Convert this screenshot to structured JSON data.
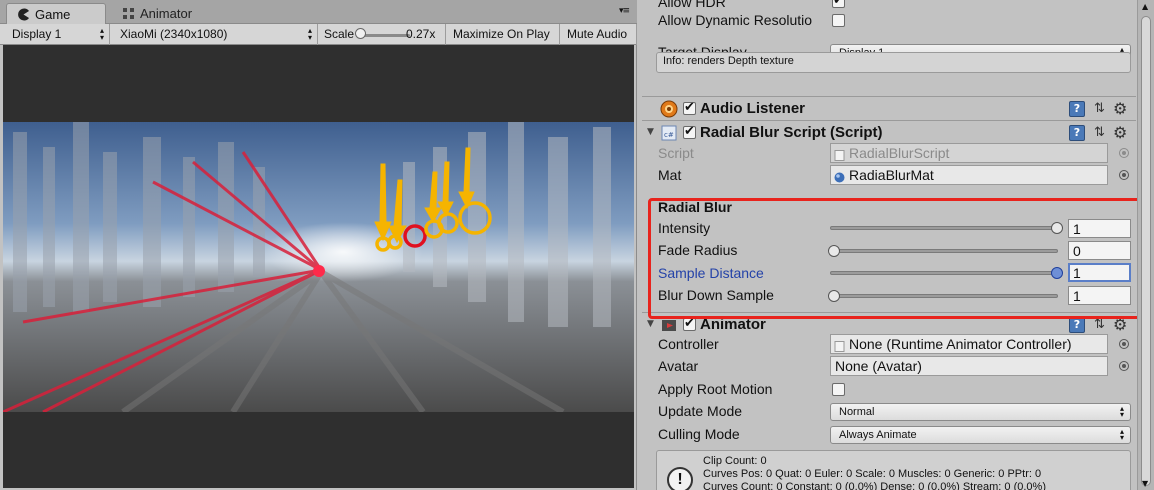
{
  "game_view": {
    "tabs": [
      {
        "label": "Game",
        "icon": "pacman-icon"
      },
      {
        "label": "Animator",
        "icon": "animator-grid-icon"
      }
    ],
    "toolbar": {
      "display": "Display 1",
      "resolution": "XiaoMi (2340x1080)",
      "scale_label": "Scale",
      "scale_value": "0.27x",
      "maximize_on_play": "Maximize On Play",
      "mute_audio": "Mute Audio"
    }
  },
  "inspector": {
    "camera": {
      "allow_hdr_label": "Allow HDR",
      "allow_dynamic_resolution_label": "Allow Dynamic Resolutio",
      "target_display_label": "Target Display",
      "target_display_value": "Display 1",
      "info_text": "Info: renders Depth texture"
    },
    "audio_listener": {
      "title": "Audio Listener"
    },
    "radial_blur_script": {
      "title": "Radial Blur Script (Script)",
      "script_label": "Script",
      "script_value": "RadialBlurScript",
      "mat_label": "Mat",
      "mat_value": "RadiaBlurMat",
      "section_title": "Radial Blur",
      "params": [
        {
          "label": "Intensity",
          "value": "1",
          "fraction": 1.0
        },
        {
          "label": "Fade Radius",
          "value": "0",
          "fraction": 0.0
        },
        {
          "label": "Sample Distance",
          "value": "1",
          "fraction": 1.0
        },
        {
          "label": "Blur Down Sample",
          "value": "1",
          "fraction": 0.0
        }
      ]
    },
    "animator": {
      "title": "Animator",
      "controller_label": "Controller",
      "controller_value": "None (Runtime Animator Controller)",
      "avatar_label": "Avatar",
      "avatar_value": "None (Avatar)",
      "apply_root_motion_label": "Apply Root Motion",
      "update_mode_label": "Update Mode",
      "update_mode_value": "Normal",
      "culling_mode_label": "Culling Mode",
      "culling_mode_value": "Always Animate",
      "stats": [
        "Clip Count: 0",
        "Curves Pos: 0 Quat: 0 Euler: 0 Scale: 0 Muscles: 0 Generic: 0 PPtr: 0",
        "Curves Count: 0 Constant: 0 (0.0%) Dense: 0 (0.0%) Stream: 0 (0.0%)"
      ]
    }
  },
  "colors": {
    "highlight": "#e8231c",
    "focus_blue": "#1e3f9c",
    "annotation_yellow": "#f5b400"
  }
}
